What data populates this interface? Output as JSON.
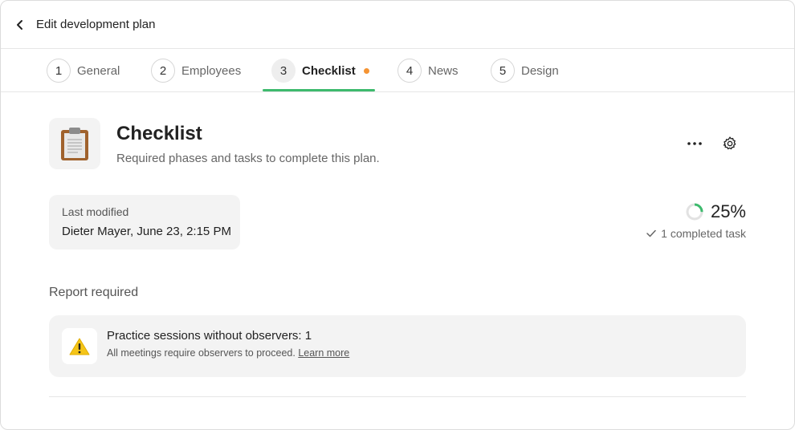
{
  "header": {
    "title": "Edit development plan"
  },
  "tabs": [
    {
      "num": "1",
      "label": "General"
    },
    {
      "num": "2",
      "label": "Employees"
    },
    {
      "num": "3",
      "label": "Checklist"
    },
    {
      "num": "4",
      "label": "News"
    },
    {
      "num": "5",
      "label": "Design"
    }
  ],
  "active_tab_index": 2,
  "page": {
    "icon": "clipboard-icon",
    "title": "Checklist",
    "subtitle": "Required phases and tasks to complete this plan."
  },
  "modified": {
    "label": "Last modified",
    "value": "Dieter Mayer, June 23, 2:15 PM"
  },
  "progress": {
    "percent_text": "25%",
    "fraction": 0.25,
    "completed_text": "1 completed task"
  },
  "report": {
    "heading": "Report required",
    "title": "Practice sessions without observers: 1",
    "description": "All meetings require observers to proceed.",
    "link": "Learn more"
  },
  "colors": {
    "accent": "#3dba6d",
    "dot": "#f59433",
    "warning": "#f5c518"
  }
}
